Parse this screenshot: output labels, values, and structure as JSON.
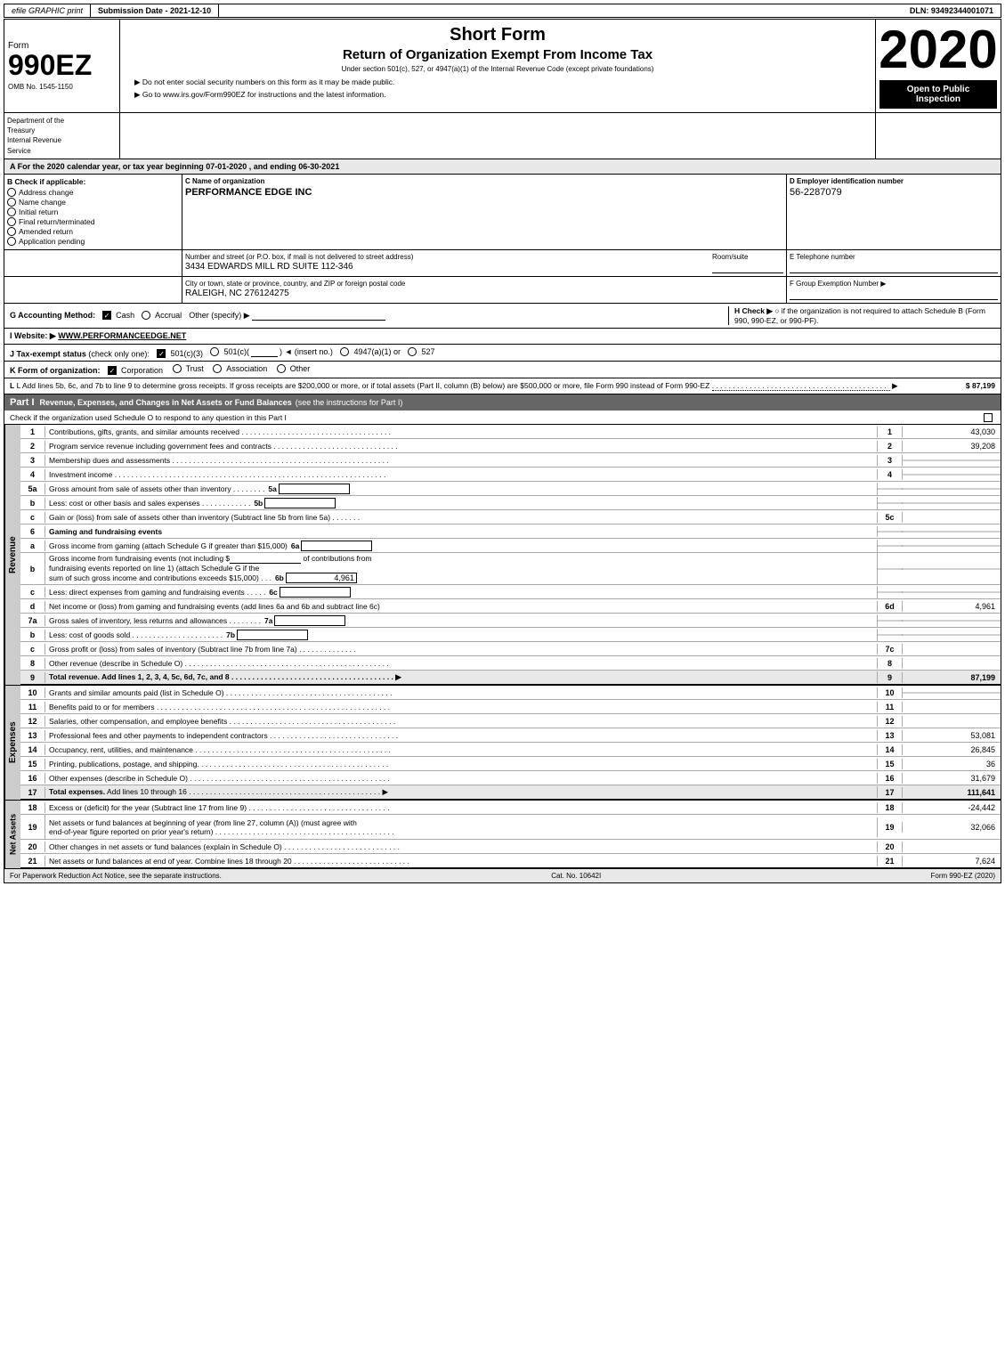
{
  "topBar": {
    "efile": "efile GRAPHIC print",
    "submission": "Submission Date - 2021-12-10",
    "dln": "DLN: 93492344001071"
  },
  "header": {
    "ombNo": "OMB No. 1545-1150",
    "formNumber": "990EZ",
    "formLabel": "Form",
    "shortFormTitle": "Short Form",
    "returnTitle": "Return of Organization Exempt From Income Tax",
    "underSection": "Under section 501(c), 527, or 4947(a)(1) of the Internal Revenue Code (except private foundations)",
    "notice1": "▶ Do not enter social security numbers on this form as it may be made public.",
    "notice2": "▶ Go to www.irs.gov/Form990EZ for instructions and the latest information.",
    "year": "2020",
    "openToPublic": "Open to Public Inspection"
  },
  "deptInfo": {
    "line1": "Department of the",
    "line2": "Treasury",
    "line3": "Internal Revenue",
    "line4": "Service"
  },
  "sectionA": {
    "text": "A For the 2020 calendar year, or tax year beginning 07-01-2020 , and ending 06-30-2021"
  },
  "checkApplicable": {
    "label": "B Check if applicable:",
    "items": [
      {
        "label": "Address change",
        "checked": false
      },
      {
        "label": "Name change",
        "checked": false
      },
      {
        "label": "Initial return",
        "checked": false
      },
      {
        "label": "Final return/terminated",
        "checked": false
      },
      {
        "label": "Amended return",
        "checked": false
      },
      {
        "label": "Application pending",
        "checked": false
      }
    ]
  },
  "orgInfo": {
    "nameLabel": "C Name of organization",
    "name": "PERFORMANCE EDGE INC",
    "addressLabel": "Number and street (or P.O. box, if mail is not delivered to street address)",
    "address": "3434 EDWARDS MILL RD SUITE 112-346",
    "roomSuiteLabel": "Room/suite",
    "roomSuite": "",
    "cityLabel": "City or town, state or province, country, and ZIP or foreign postal code",
    "city": "RALEIGH, NC  276124275"
  },
  "einInfo": {
    "label": "D Employer identification number",
    "ein": "56-2287079",
    "phoneLabel": "E Telephone number",
    "phone": "",
    "groupLabel": "F Group Exemption",
    "groupSub": "Number",
    "groupNum": ""
  },
  "accounting": {
    "gLabel": "G Accounting Method:",
    "cashLabel": "Cash",
    "cashChecked": true,
    "accrualLabel": "Accrual",
    "accrualChecked": false,
    "otherLabel": "Other (specify) ▶",
    "hLabel": "H Check ▶",
    "hText": "○ if the organization is not required to attach Schedule B (Form 990, 990-EZ, or 990-PF)."
  },
  "website": {
    "label": "I Website: ▶",
    "url": "WWW.PERFORMANCEEDGE.NET"
  },
  "taxExempt": {
    "label": "J Tax-exempt status",
    "note": "(check only one):",
    "options": [
      {
        "label": "501(c)(3)",
        "checked": true
      },
      {
        "label": "501(c)(",
        "checked": false
      },
      {
        "label": ") ◄ (insert no.)",
        "checked": false
      },
      {
        "label": "4947(a)(1) or",
        "checked": false
      },
      {
        "label": "527",
        "checked": false
      }
    ]
  },
  "formK": {
    "label": "K Form of organization:",
    "options": [
      {
        "label": "Corporation",
        "checked": true
      },
      {
        "label": "Trust",
        "checked": false
      },
      {
        "label": "Association",
        "checked": false
      },
      {
        "label": "Other",
        "checked": false
      }
    ]
  },
  "lineL": {
    "text": "L Add lines 5b, 6c, and 7b to line 9 to determine gross receipts. If gross receipts are $200,000 or more, or if total assets (Part II, column (B) below) are $500,000 or more, file Form 990 instead of Form 990-EZ",
    "value": "$ 87,199"
  },
  "partI": {
    "title": "Part I",
    "subtitle": "Revenue, Expenses, and Changes in Net Assets or Fund Balances",
    "instruction": "(see the instructions for Part I)",
    "checkLine": "Check if the organization used Schedule O to respond to any question in this Part I",
    "rows": [
      {
        "num": "1",
        "desc": "Contributions, gifts, grants, and similar amounts received",
        "lineNum": "1",
        "value": "43,030"
      },
      {
        "num": "2",
        "desc": "Program service revenue including government fees and contracts",
        "lineNum": "2",
        "value": "39,208"
      },
      {
        "num": "3",
        "desc": "Membership dues and assessments",
        "lineNum": "3",
        "value": ""
      },
      {
        "num": "4",
        "desc": "Investment income",
        "lineNum": "4",
        "value": ""
      },
      {
        "num": "5a",
        "desc": "Gross amount from sale of assets other than inventory",
        "lineNum": "5a",
        "value": "",
        "inline": true
      },
      {
        "num": "5b",
        "desc": "Less: cost or other basis and sales expenses",
        "lineNum": "5b",
        "value": "",
        "inline": true
      },
      {
        "num": "5c",
        "desc": "Gain or (loss) from sale of assets other than inventory (Subtract line 5b from line 5a)",
        "lineNum": "5c",
        "value": ""
      },
      {
        "num": "6",
        "desc": "Gaming and fundraising events",
        "lineNum": "",
        "value": "",
        "header": true
      },
      {
        "num": "6a",
        "desc": "Gross income from gaming (attach Schedule G if greater than $15,000)",
        "lineNum": "6a",
        "value": "",
        "inline": true
      },
      {
        "num": "6b",
        "desc": "Gross income from fundraising events (not including $_____ of contributions from fundraising events reported on line 1) (attach Schedule G if the sum of such gross income and contributions exceeds $15,000)",
        "lineNum": "6b",
        "value": "4,961",
        "inlineRight": true
      },
      {
        "num": "6c",
        "desc": "Less: direct expenses from gaming and fundraising events",
        "lineNum": "6c",
        "value": "",
        "inlineRight2": true
      },
      {
        "num": "6d",
        "desc": "Net income or (loss) from gaming and fundraising events (add lines 6a and 6b and subtract line 6c)",
        "lineNum": "6d",
        "value": "4,961"
      },
      {
        "num": "7a",
        "desc": "Gross sales of inventory, less returns and allowances",
        "lineNum": "7a",
        "value": "",
        "inline": true
      },
      {
        "num": "7b",
        "desc": "Less: cost of goods sold",
        "lineNum": "7b",
        "value": "",
        "inline": true
      },
      {
        "num": "7c",
        "desc": "Gross profit or (loss) from sales of inventory (Subtract line 7b from line 7a)",
        "lineNum": "7c",
        "value": ""
      },
      {
        "num": "8",
        "desc": "Other revenue (describe in Schedule O)",
        "lineNum": "8",
        "value": ""
      },
      {
        "num": "9",
        "desc": "Total revenue. Add lines 1, 2, 3, 4, 5c, 6d, 7c, and 8",
        "lineNum": "9",
        "value": "87,199",
        "total": true
      }
    ]
  },
  "expenses": {
    "rows": [
      {
        "num": "10",
        "desc": "Grants and similar amounts paid (list in Schedule O)",
        "lineNum": "10",
        "value": ""
      },
      {
        "num": "11",
        "desc": "Benefits paid to or for members",
        "lineNum": "11",
        "value": ""
      },
      {
        "num": "12",
        "desc": "Salaries, other compensation, and employee benefits",
        "lineNum": "12",
        "value": ""
      },
      {
        "num": "13",
        "desc": "Professional fees and other payments to independent contractors",
        "lineNum": "13",
        "value": "53,081"
      },
      {
        "num": "14",
        "desc": "Occupancy, rent, utilities, and maintenance",
        "lineNum": "14",
        "value": "26,845"
      },
      {
        "num": "15",
        "desc": "Printing, publications, postage, and shipping",
        "lineNum": "15",
        "value": "36"
      },
      {
        "num": "16",
        "desc": "Other expenses (describe in Schedule O)",
        "lineNum": "16",
        "value": "31,679"
      },
      {
        "num": "17",
        "desc": "Total expenses. Add lines 10 through 16",
        "lineNum": "17",
        "value": "111,641",
        "total": true
      }
    ]
  },
  "netAssets": {
    "rows": [
      {
        "num": "18",
        "desc": "Excess or (deficit) for the year (Subtract line 17 from line 9)",
        "lineNum": "18",
        "value": "-24,442"
      },
      {
        "num": "19",
        "desc": "Net assets or fund balances at beginning of year (from line 27, column (A)) (must agree with end-of-year figure reported on prior year's return)",
        "lineNum": "19",
        "value": "32,066"
      },
      {
        "num": "20",
        "desc": "Other changes in net assets or fund balances (explain in Schedule O)",
        "lineNum": "20",
        "value": ""
      },
      {
        "num": "21",
        "desc": "Net assets or fund balances at end of year. Combine lines 18 through 20",
        "lineNum": "21",
        "value": "7,624"
      }
    ]
  },
  "footer": {
    "paperwork": "For Paperwork Reduction Act Notice, see the separate instructions.",
    "catNo": "Cat. No. 10642I",
    "form": "Form 990-EZ (2020)"
  }
}
